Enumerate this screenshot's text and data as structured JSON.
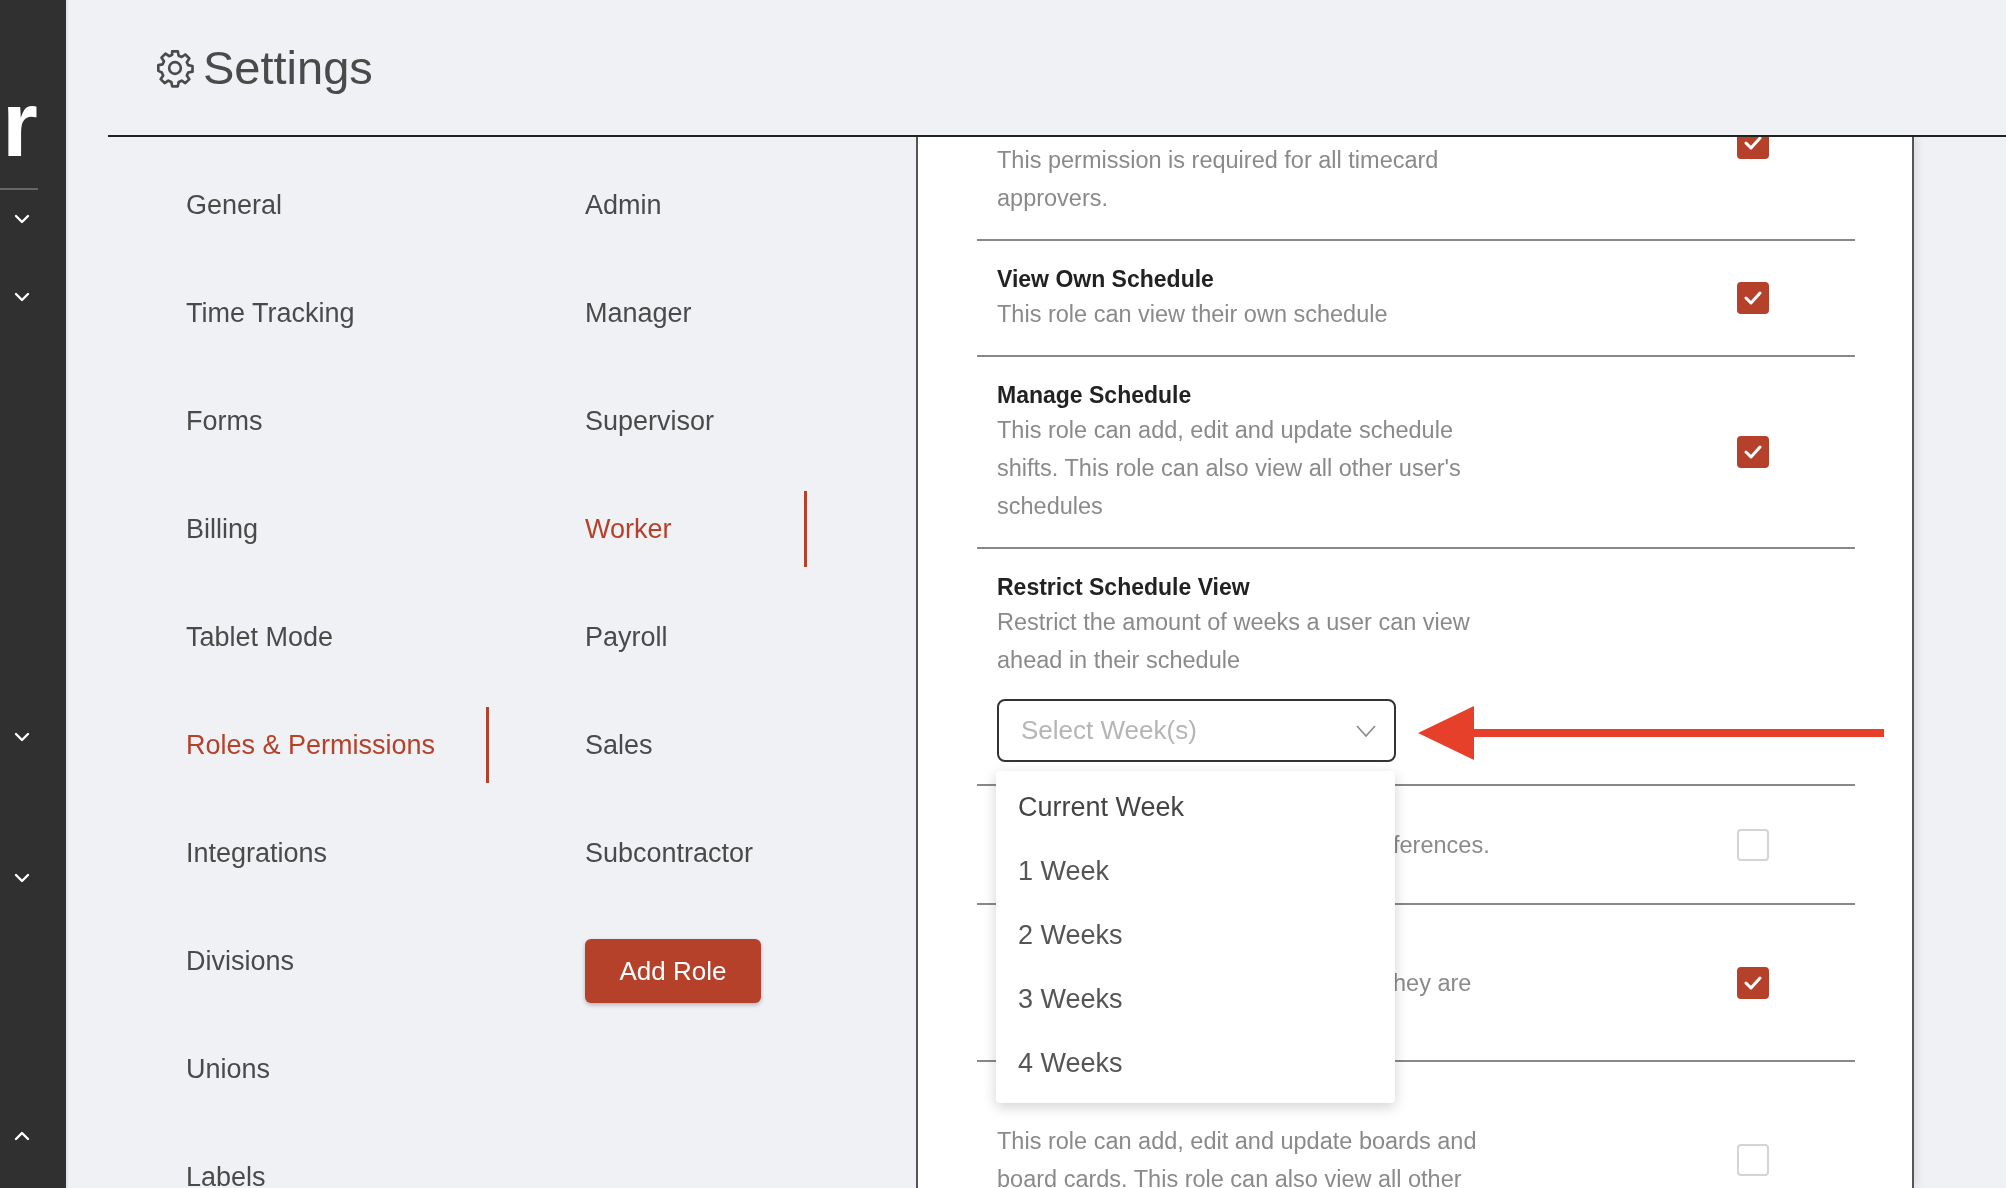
{
  "sidebar": {
    "logo": "r",
    "toggles": [
      {
        "expanded": false
      },
      {
        "expanded": false
      },
      {
        "expanded": false
      },
      {
        "expanded": false
      },
      {
        "expanded": true
      }
    ]
  },
  "header": {
    "title": "Settings"
  },
  "nav_columns": [
    [
      {
        "label": "General",
        "selected": false
      },
      {
        "label": "Time Tracking",
        "selected": false
      },
      {
        "label": "Forms",
        "selected": false
      },
      {
        "label": "Billing",
        "selected": false
      },
      {
        "label": "Tablet Mode",
        "selected": false
      },
      {
        "label": "Roles & Permissions",
        "selected": true
      },
      {
        "label": "Integrations",
        "selected": false
      },
      {
        "label": "Divisions",
        "selected": false
      },
      {
        "label": "Unions",
        "selected": false
      },
      {
        "label": "Labels",
        "selected": false
      }
    ],
    [
      {
        "label": "Admin",
        "selected": false
      },
      {
        "label": "Manager",
        "selected": false
      },
      {
        "label": "Supervisor",
        "selected": false
      },
      {
        "label": "Worker",
        "selected": true
      },
      {
        "label": "Payroll",
        "selected": false
      },
      {
        "label": "Sales",
        "selected": false
      },
      {
        "label": "Subcontractor",
        "selected": false
      }
    ]
  ],
  "add_role_button": "Add Role",
  "permissions": [
    {
      "kind": "top",
      "description": "This permission is required for all timecard approvers.",
      "checked": true
    },
    {
      "kind": "full",
      "title": "View Own Schedule",
      "description": "This role can view their own schedule",
      "checked": true
    },
    {
      "kind": "full",
      "title": "Manage Schedule",
      "description": "This role can add, edit and update schedule shifts. This role can also view all other user's schedules",
      "checked": true
    },
    {
      "kind": "select",
      "title": "Restrict Schedule View",
      "description": "Restrict the amount of weeks a user can view ahead in their schedule",
      "placeholder": "Select Week(s)",
      "expanded": true,
      "options": [
        "Current Week",
        "1 Week",
        "2 Weeks",
        "3 Weeks",
        "4 Weeks"
      ]
    },
    {
      "kind": "partial",
      "description": "ferences.",
      "checked": false
    },
    {
      "kind": "partial",
      "description": "hey are",
      "checked": true
    },
    {
      "kind": "bottom",
      "description": "This role can add, edit and update boards and board cards. This role can also view all other",
      "checked": false
    }
  ]
}
